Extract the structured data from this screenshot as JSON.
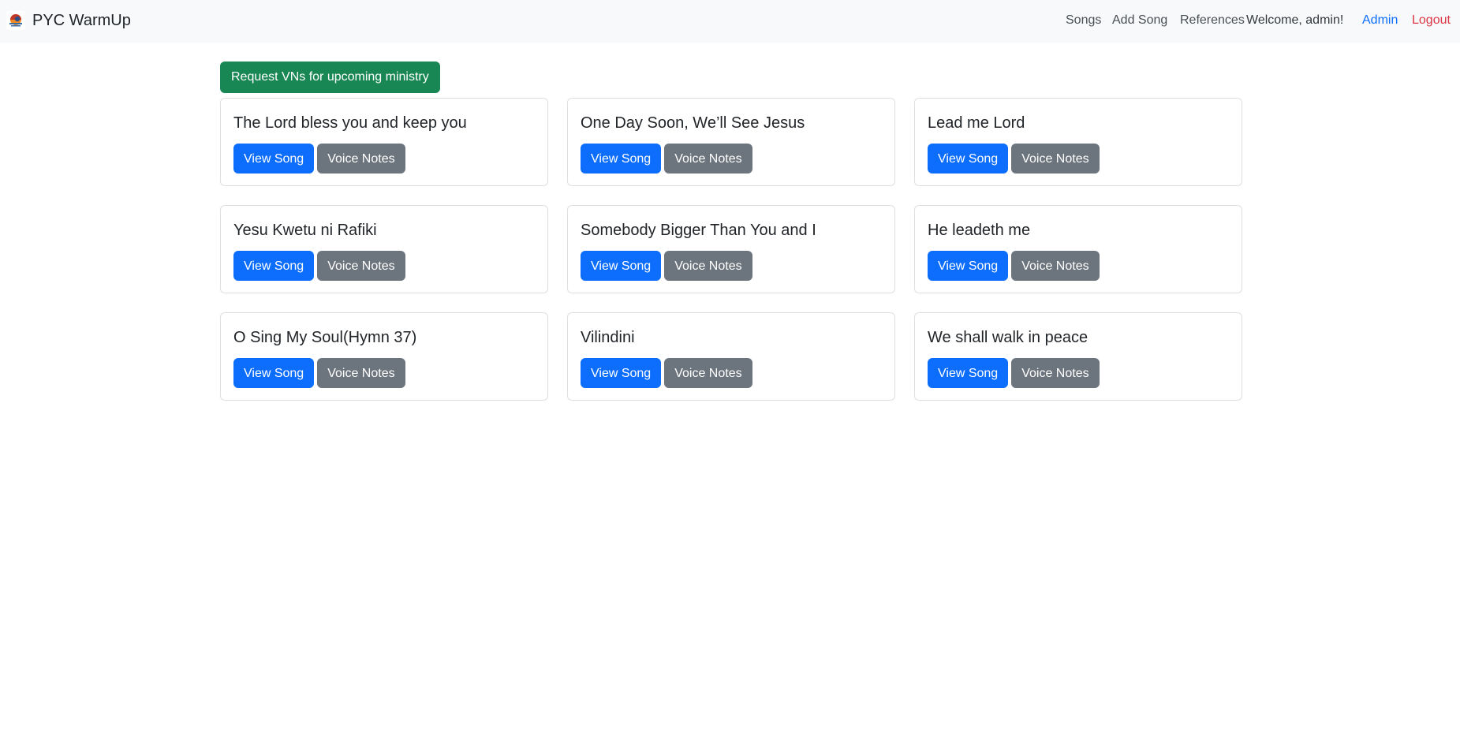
{
  "brand": {
    "title": "PYC WarmUp",
    "logo_icon": "sunset-logo-icon"
  },
  "nav": {
    "songs": "Songs",
    "add_song": "Add Song",
    "references": "References",
    "welcome": "Welcome, admin!",
    "admin": "Admin",
    "logout": "Logout"
  },
  "colors": {
    "navbar_bg": "#f8f9fa",
    "primary": "#0d6efd",
    "secondary": "#6c757d",
    "success": "#198754",
    "danger": "#dc3545"
  },
  "main": {
    "request_button": "Request VNs for upcoming ministry",
    "songs": [
      {
        "title": "The Lord bless you and keep you",
        "view_label": "View Song",
        "voice_label": "Voice Notes"
      },
      {
        "title": "One Day Soon, We’ll See Jesus",
        "view_label": "View Song",
        "voice_label": "Voice Notes"
      },
      {
        "title": "Lead me Lord",
        "view_label": "View Song",
        "voice_label": "Voice Notes"
      },
      {
        "title": "Yesu Kwetu ni Rafiki",
        "view_label": "View Song",
        "voice_label": "Voice Notes"
      },
      {
        "title": "Somebody Bigger Than You and I",
        "view_label": "View Song",
        "voice_label": "Voice Notes"
      },
      {
        "title": "He leadeth me",
        "view_label": "View Song",
        "voice_label": "Voice Notes"
      },
      {
        "title": "O Sing My Soul(Hymn 37)",
        "view_label": "View Song",
        "voice_label": "Voice Notes"
      },
      {
        "title": "Vilindini",
        "view_label": "View Song",
        "voice_label": "Voice Notes"
      },
      {
        "title": "We shall walk in peace",
        "view_label": "View Song",
        "voice_label": "Voice Notes"
      }
    ]
  }
}
